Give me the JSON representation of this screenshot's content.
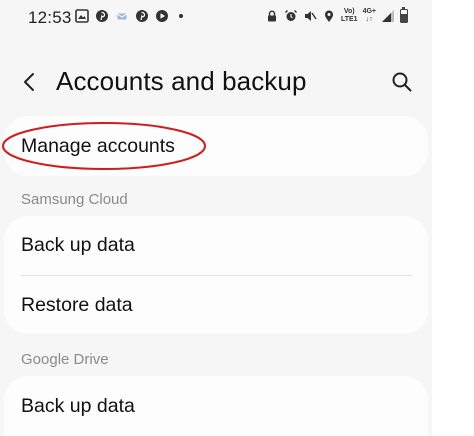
{
  "status_bar": {
    "time": "12:53",
    "left_icons": [
      "gallery-icon",
      "pinterest-icon",
      "message-icon",
      "pinterest-icon",
      "play-icon",
      "dot-icon"
    ],
    "right_icons": [
      "lock-icon",
      "alarm-icon",
      "mute-icon",
      "location-icon",
      "volte-icon",
      "4g-icon",
      "signal-icon",
      "battery-icon"
    ],
    "volte_line1": "Vo)",
    "volte_line2": "LTE1",
    "net_line1": "4G+",
    "battery_level": 0.7
  },
  "header": {
    "title": "Accounts and backup",
    "back_icon": "back-arrow-icon",
    "search_icon": "search-icon"
  },
  "main": {
    "manage_accounts": {
      "label": "Manage accounts"
    },
    "samsung_cloud": {
      "section_label": "Samsung Cloud",
      "items": [
        {
          "label": "Back up data"
        },
        {
          "label": "Restore data"
        }
      ]
    },
    "google_drive": {
      "section_label": "Google Drive",
      "items": [
        {
          "label": "Back up data"
        }
      ]
    }
  },
  "annotation": {
    "color": "#cc1f1f",
    "target": "Manage accounts"
  }
}
